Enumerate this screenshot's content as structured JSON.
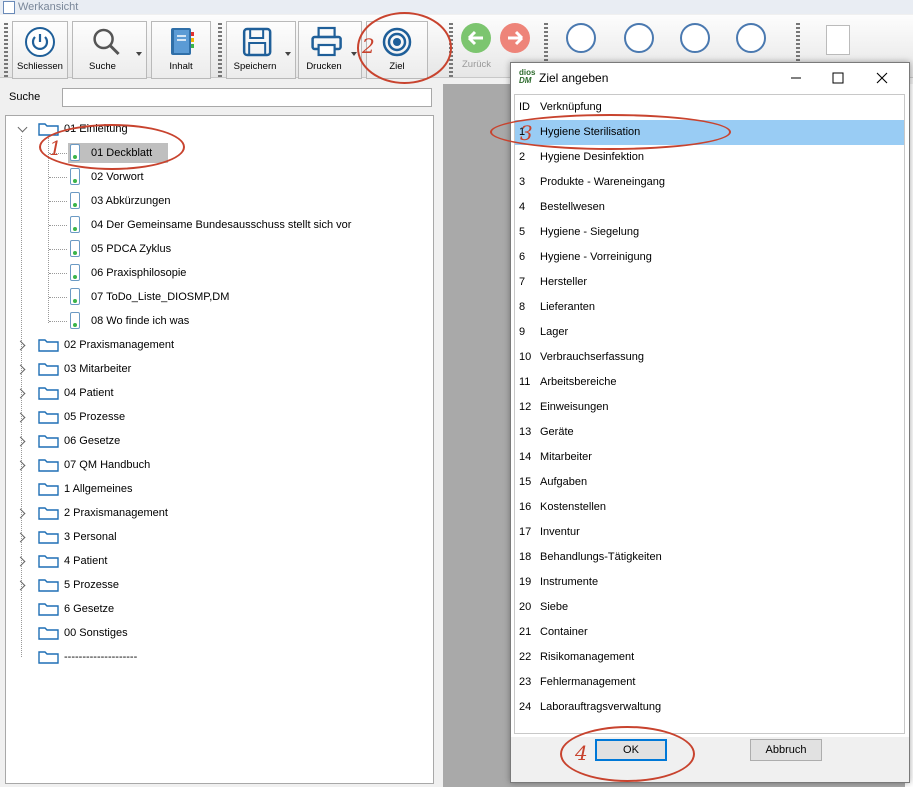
{
  "window": {
    "title": "Werkansicht"
  },
  "toolbar": {
    "buttons": [
      {
        "label": "Schliessen",
        "icon": "power-icon"
      },
      {
        "label": "Suche",
        "icon": "magnifier-icon"
      },
      {
        "label": "Inhalt",
        "icon": "book-icon"
      },
      {
        "label": "Speichern",
        "icon": "floppy-icon"
      },
      {
        "label": "Drucken",
        "icon": "printer-icon"
      },
      {
        "label": "Ziel",
        "icon": "target-icon"
      }
    ],
    "back_label": "Zurück"
  },
  "search": {
    "label": "Suche",
    "value": ""
  },
  "tree": {
    "root": {
      "label": "01 Einleitung",
      "expanded": true
    },
    "children": [
      {
        "label": "01 Deckblatt",
        "selected": true
      },
      {
        "label": "02 Vorwort"
      },
      {
        "label": "03 Abkürzungen"
      },
      {
        "label": "04 Der Gemeinsame Bundesausschuss stellt sich vor"
      },
      {
        "label": "05 PDCA Zyklus"
      },
      {
        "label": "06 Praxisphilosopie"
      },
      {
        "label": "07 ToDo_Liste_DIOSMP,DM"
      },
      {
        "label": "08 Wo finde ich was"
      }
    ],
    "folders": [
      {
        "label": "02 Praxismanagement",
        "expandable": true
      },
      {
        "label": "03 Mitarbeiter",
        "expandable": true
      },
      {
        "label": "04 Patient",
        "expandable": true
      },
      {
        "label": "05 Prozesse",
        "expandable": true
      },
      {
        "label": "06 Gesetze",
        "expandable": true
      },
      {
        "label": "07 QM Handbuch",
        "expandable": true
      },
      {
        "label": "1 Allgemeines",
        "expandable": false
      },
      {
        "label": "2 Praxismanagement",
        "expandable": true
      },
      {
        "label": "3 Personal",
        "expandable": true
      },
      {
        "label": "4 Patient",
        "expandable": true
      },
      {
        "label": "5 Prozesse",
        "expandable": true
      },
      {
        "label": "6 Gesetze",
        "expandable": false
      },
      {
        "label": "00 Sonstiges",
        "expandable": false
      },
      {
        "label": "--------------------",
        "expandable": false
      }
    ]
  },
  "dialog": {
    "icon_text_top": "dios",
    "icon_text_bottom": "DM",
    "title": "Ziel angeben",
    "columns": {
      "id": "ID",
      "name": "Verknüpfung"
    },
    "rows": [
      {
        "id": "1",
        "name": "Hygiene Sterilisation",
        "selected": true
      },
      {
        "id": "2",
        "name": "Hygiene Desinfektion"
      },
      {
        "id": "3",
        "name": "Produkte - Wareneingang"
      },
      {
        "id": "4",
        "name": "Bestellwesen"
      },
      {
        "id": "5",
        "name": "Hygiene - Siegelung"
      },
      {
        "id": "6",
        "name": "Hygiene - Vorreinigung"
      },
      {
        "id": "7",
        "name": "Hersteller"
      },
      {
        "id": "8",
        "name": "Lieferanten"
      },
      {
        "id": "9",
        "name": "Lager"
      },
      {
        "id": "10",
        "name": "Verbrauchserfassung"
      },
      {
        "id": "11",
        "name": "Arbeitsbereiche"
      },
      {
        "id": "12",
        "name": "Einweisungen"
      },
      {
        "id": "13",
        "name": "Geräte"
      },
      {
        "id": "14",
        "name": "Mitarbeiter"
      },
      {
        "id": "15",
        "name": "Aufgaben"
      },
      {
        "id": "16",
        "name": "Kostenstellen"
      },
      {
        "id": "17",
        "name": "Inventur"
      },
      {
        "id": "18",
        "name": "Behandlungs-Tätigkeiten"
      },
      {
        "id": "19",
        "name": "Instrumente"
      },
      {
        "id": "20",
        "name": "Siebe"
      },
      {
        "id": "21",
        "name": "Container"
      },
      {
        "id": "22",
        "name": "Risikomanagement"
      },
      {
        "id": "23",
        "name": "Fehlermanagement"
      },
      {
        "id": "24",
        "name": "Laborauftragsverwaltung"
      }
    ],
    "ok_label": "OK",
    "cancel_label": "Abbruch"
  },
  "annotations": [
    {
      "number": "1",
      "target": "tree-item-deckblatt"
    },
    {
      "number": "2",
      "target": "ziel-button"
    },
    {
      "number": "3",
      "target": "hygiene-sterilisation-row"
    },
    {
      "number": "4",
      "target": "ok-button"
    }
  ],
  "colors": {
    "annotation": "#c8432e",
    "selection": "#99ccf4",
    "accent": "#0078d7"
  }
}
